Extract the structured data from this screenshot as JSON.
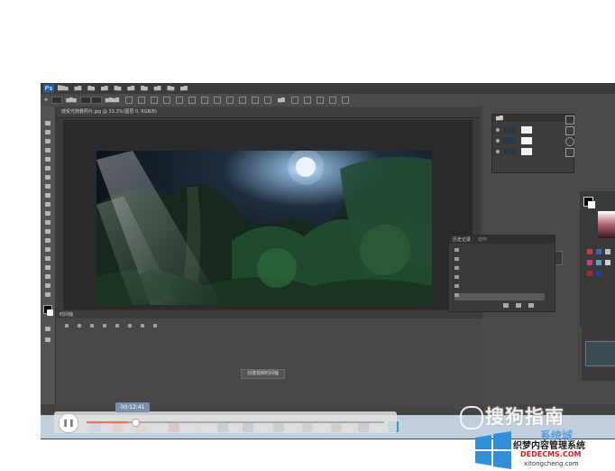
{
  "app": {
    "logo": "Ps"
  },
  "document": {
    "tab_title": "感受光随着照片.jpg @ 33.3%(图层 0, RGB/8)"
  },
  "timeline": {
    "tab_label": "时间轴",
    "create_button": "创建视频时间轴"
  },
  "history_panel": {
    "tabs": [
      "历史记录",
      "动作"
    ],
    "items": [
      "",
      "",
      "",
      "",
      "",
      ""
    ]
  },
  "player": {
    "time": "00:12:41",
    "progress_percent": 14
  },
  "watermark": {
    "sogou": "搜狗指南",
    "site_title": "织梦内容管理系统",
    "site_domain": "DEDECMS.COM",
    "site_alt": "xitongcheng.com",
    "partial": "系统城"
  }
}
